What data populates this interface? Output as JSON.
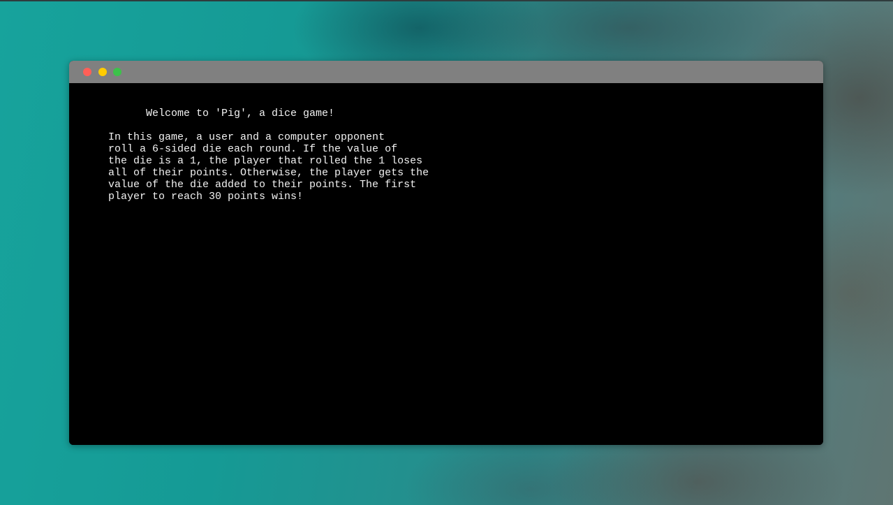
{
  "window": {
    "controls": {
      "close": {
        "icon": "close-dot-icon",
        "color": "#ff5f57"
      },
      "minimize": {
        "icon": "minimize-dot-icon",
        "color": "#ffcc00"
      },
      "maximize": {
        "icon": "maximize-dot-icon",
        "color": "#3cc24a"
      }
    },
    "titlebar_color": "#808080"
  },
  "terminal": {
    "background": "#000000",
    "foreground": "#f2f2f2",
    "output": "      Welcome to 'Pig', a dice game!\n\nIn this game, a user and a computer opponent\nroll a 6-sided die each round. If the value of\nthe die is a 1, the player that rolled the 1 loses\nall of their points. Otherwise, the player gets the\nvalue of the die added to their points. The first\nplayer to reach 30 points wins!"
  }
}
